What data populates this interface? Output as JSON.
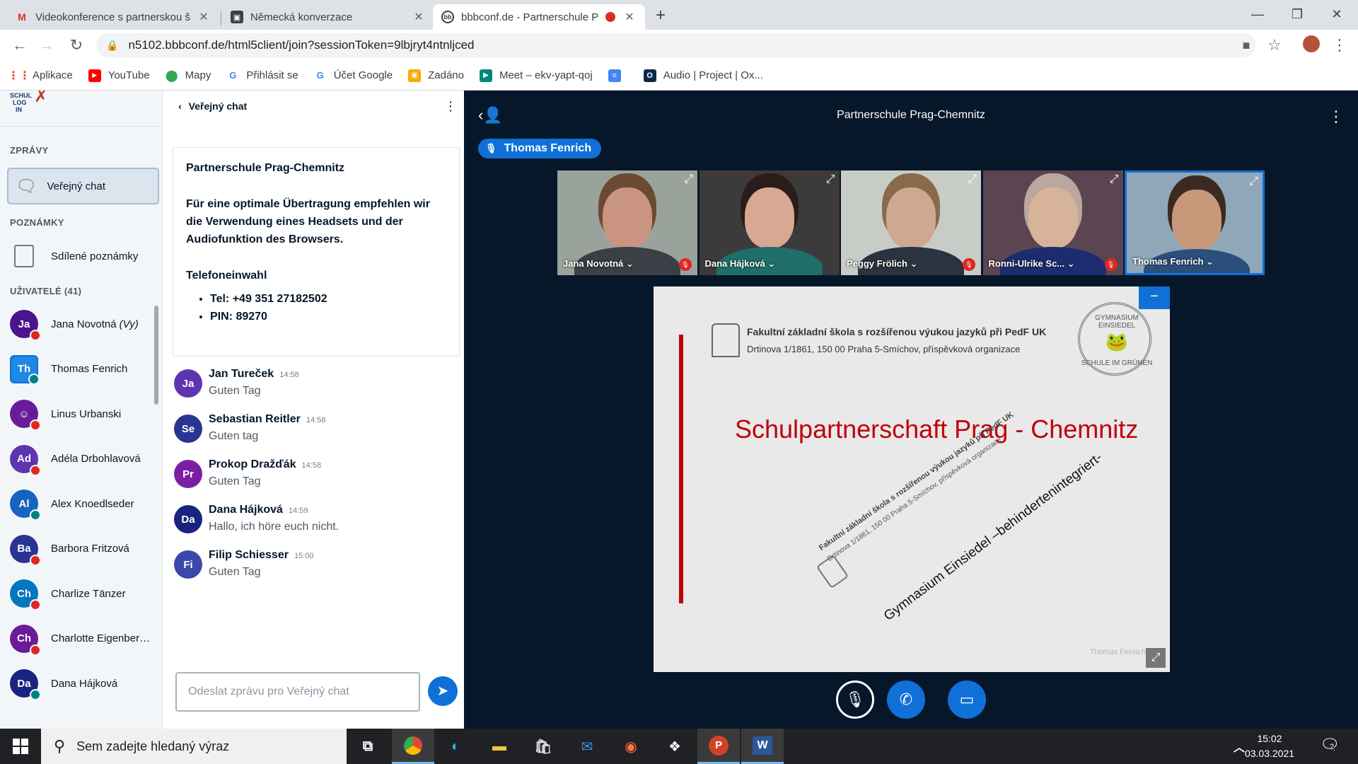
{
  "browser": {
    "tabs": [
      {
        "title": "Videokonference s partnerskou š",
        "icon": "gmail-icon",
        "close": "✕"
      },
      {
        "title": "Německá konverzace",
        "icon": "classroom-icon",
        "close": "✕"
      },
      {
        "title": "bbbconf.de - Partnerschule P",
        "icon": "bbb-icon",
        "close": "✕"
      }
    ],
    "new_tab": "+",
    "url": "n5102.bbbconf.de/html5client/join?sessionToken=9lbjryt4ntnljced",
    "bookmarks": [
      "Aplikace",
      "YouTube",
      "Mapy",
      "Přihlásit se",
      "Účet Google",
      "Zadáno",
      "Meet – ekv-yapt-qoj",
      "",
      "Audio | Project | Ox..."
    ]
  },
  "sidebar": {
    "logo_lines": [
      "SCHUL",
      "LOG",
      "IN"
    ],
    "messages_title": "ZPRÁVY",
    "public_chat_label": "Veřejný chat",
    "notes_title": "POZNÁMKY",
    "shared_notes_label": "Sdílené poznámky",
    "users_title": "UŽIVATELÉ (41)",
    "users": [
      {
        "initials": "Ja",
        "name": "Jana Novotná",
        "you": "(Vy)",
        "color": "#4a148c",
        "mic": "muted"
      },
      {
        "initials": "Th",
        "name": "Thomas Fenrich",
        "you": "",
        "color": "#1e88e5",
        "mic": "on",
        "presenter": true
      },
      {
        "initials": "☺",
        "name": "Linus Urbanski",
        "you": "",
        "color": "#6a1b9a",
        "mic": "muted"
      },
      {
        "initials": "Ad",
        "name": "Adéla Drbohlavová",
        "you": "",
        "color": "#5e35b1",
        "mic": "muted"
      },
      {
        "initials": "Al",
        "name": "Alex Knoedlseder",
        "you": "",
        "color": "#1565c0",
        "mic": "on"
      },
      {
        "initials": "Ba",
        "name": "Barbora Fritzová",
        "you": "",
        "color": "#283593",
        "mic": "muted"
      },
      {
        "initials": "Ch",
        "name": "Charlize Tänzer",
        "you": "",
        "color": "#0277bd",
        "mic": "muted"
      },
      {
        "initials": "Ch",
        "name": "Charlotte Eigenberg…",
        "you": "",
        "color": "#6a1b9a",
        "mic": "muted"
      },
      {
        "initials": "Da",
        "name": "Dana Hájková",
        "you": "",
        "color": "#1a237e",
        "mic": "on"
      }
    ]
  },
  "chat": {
    "header": "Veřejný chat",
    "welcome": {
      "title": "Partnerschule Prag-Chemnitz",
      "body": "Für eine optimale Übertragung empfehlen wir die Verwendung eines Headsets und der Audiofunktion des Browsers.",
      "phone_title": "Telefoneinwahl",
      "phone": "Tel: +49 351 27182502",
      "pin": "PIN: 89270"
    },
    "messages": [
      {
        "initials": "Ja",
        "name": "Jan Tureček",
        "time": "14:58",
        "text": "Guten Tag",
        "color": "#5e35b1"
      },
      {
        "initials": "Se",
        "name": "Sebastian Reitler",
        "time": "14:58",
        "text": "Guten tag",
        "color": "#283593"
      },
      {
        "initials": "Pr",
        "name": "Prokop Dražďák",
        "time": "14:58",
        "text": "Guten Tag",
        "color": "#7b1fa2"
      },
      {
        "initials": "Da",
        "name": "Dana Hájková",
        "time": "14:59",
        "text": "Hallo, ich höre euch nicht.",
        "color": "#1a237e"
      },
      {
        "initials": "Fi",
        "name": "Filip Schiesser",
        "time": "15:00",
        "text": "Guten Tag",
        "color": "#3949ab"
      }
    ],
    "input_placeholder": "Odeslat zprávu pro Veřejný chat"
  },
  "meeting": {
    "title": "Partnerschule Prag-Chemnitz",
    "talking": "Thomas Fenrich",
    "videos": [
      {
        "name": "Jana Novotná",
        "muted": true,
        "bg": "#9aa39b",
        "skin": "#c99580",
        "hair": "#6b4a34",
        "shirt": "#3b3f46"
      },
      {
        "name": "Dana Hájková",
        "muted": false,
        "bg": "#3c3a3a",
        "skin": "#d9a892",
        "hair": "#2a1d1a",
        "shirt": "#1f6e6a"
      },
      {
        "name": "Peggy Frölich",
        "muted": true,
        "bg": "#c8ccc6",
        "skin": "#cfa891",
        "hair": "#8a6a4a",
        "shirt": "#2c3340"
      },
      {
        "name": "Ronni-Ulrike Sc...",
        "muted": true,
        "bg": "#5a4550",
        "skin": "#d7b39a",
        "hair": "#b9a7a0",
        "shirt": "#1d2c6e"
      },
      {
        "name": "Thomas Fenrich",
        "muted": false,
        "bg": "#8fa7b8",
        "skin": "#c79879",
        "hair": "#3b2a22",
        "shirt": "#2b4f7c",
        "speaking": true
      }
    ],
    "slide": {
      "school": "Fakultní základní škola s rozšířenou výukou jazyků při PedF UK",
      "address": "Drtinova 1/1861, 150 00 Praha 5-Smíchov, příspěvková organizace",
      "stamp_top": "GYMNASIUM EINSIEDEL",
      "stamp_bottom": "SCHULE IM GRÜNEN",
      "headline": "Schulpartnerschaft Prag - Chemnitz",
      "diag_school": "Fakultní základní škola s rozšířenou výukou jazyků při PedF UK",
      "diag_address": "Drtinova 1/1861, 150 00 Praha 5-Smíchov, příspěvková organizace",
      "diag_gym": "Gymnasium Einsiedel –behindertenintegriert-",
      "watermark": "Thomas Fenrich"
    }
  },
  "taskbar": {
    "search_placeholder": "Sem zadejte hledaný výraz",
    "time": "15:02",
    "date": "03.03.2021",
    "notifications": "2"
  }
}
